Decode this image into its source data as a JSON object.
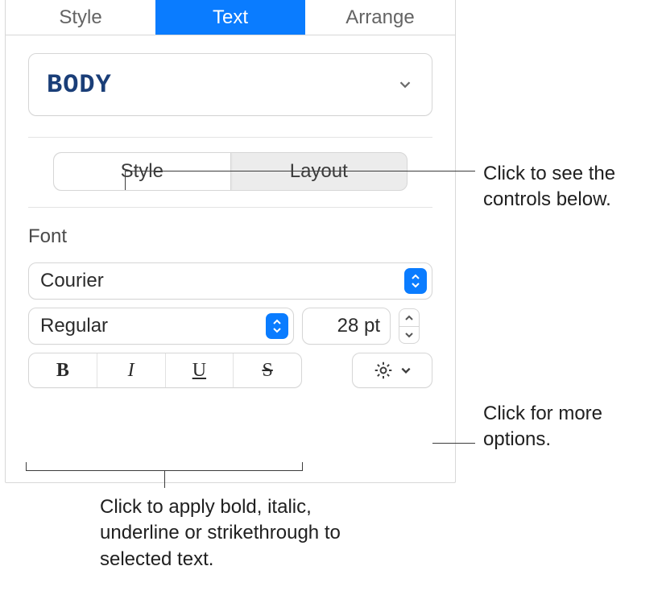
{
  "top_tabs": {
    "style": "Style",
    "text": "Text",
    "arrange": "Arrange"
  },
  "paragraph_style": "BODY",
  "subtabs": {
    "style": "Style",
    "layout": "Layout"
  },
  "font_section_label": "Font",
  "font_family": "Courier",
  "font_weight": "Regular",
  "font_size": "28 pt",
  "bius": {
    "bold": "B",
    "italic": "I",
    "underline": "U",
    "strike": "S"
  },
  "callouts": {
    "seg": "Click to see the controls below.",
    "gear": "Click for more options.",
    "bius": "Click to apply bold, italic, underline or strikethrough to selected text."
  }
}
